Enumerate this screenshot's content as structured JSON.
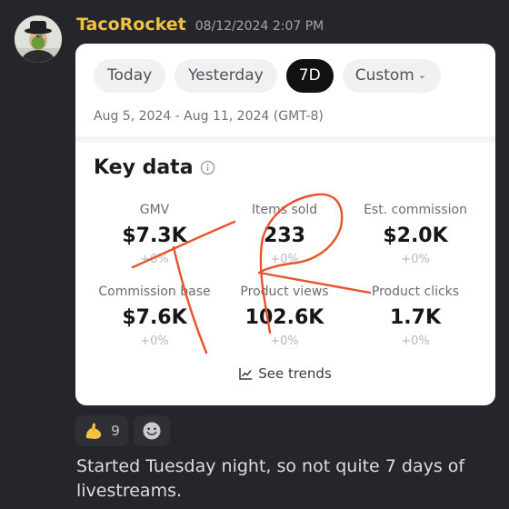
{
  "message": {
    "username": "TacoRocket",
    "timestamp": "08/12/2024 2:07 PM",
    "text": "Started Tuesday night, so not quite 7 days of livestreams.",
    "reactions": [
      {
        "emoji": "flexed-biceps",
        "count": "9"
      }
    ]
  },
  "card": {
    "tabs": [
      "Today",
      "Yesterday",
      "7D",
      "Custom"
    ],
    "active_tab": "7D",
    "date_range": "Aug 5, 2024 - Aug 11, 2024 (GMT-8)",
    "section_title": "Key data",
    "metrics": [
      {
        "label": "GMV",
        "value": "$7.3K",
        "change": "+0%"
      },
      {
        "label": "Items sold",
        "value": "233",
        "change": "+0%"
      },
      {
        "label": "Est. commission",
        "value": "$2.0K",
        "change": "+0%"
      },
      {
        "label": "Commission base",
        "value": "$7.6K",
        "change": "+0%"
      },
      {
        "label": "Product views",
        "value": "102.6K",
        "change": "+0%"
      },
      {
        "label": "Product clicks",
        "value": "1.7K",
        "change": "+0%"
      }
    ],
    "see_trends": "See trends",
    "annotation_color": "#e8522a"
  }
}
